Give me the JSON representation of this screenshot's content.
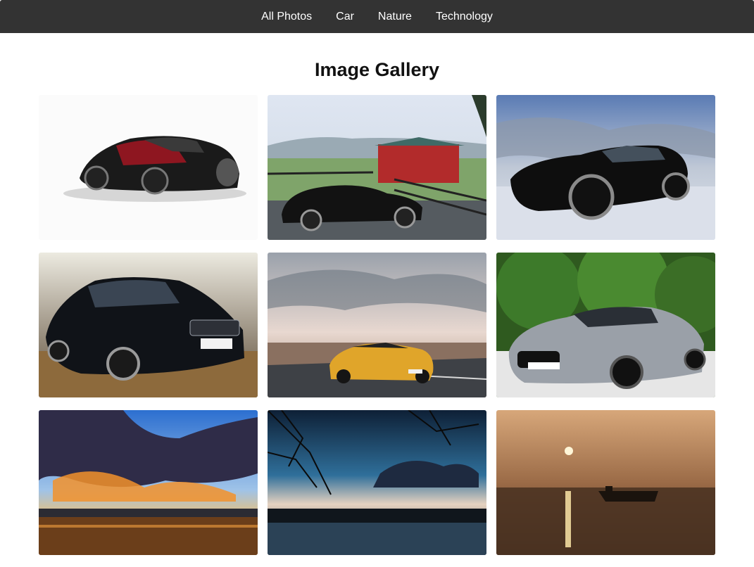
{
  "nav": {
    "items": [
      {
        "label": "All Photos"
      },
      {
        "label": "Car"
      },
      {
        "label": "Nature"
      },
      {
        "label": "Technology"
      }
    ]
  },
  "page": {
    "title": "Image Gallery"
  },
  "gallery": {
    "images": [
      {
        "subject": "red-black-supercar-photo",
        "category": "Car"
      },
      {
        "subject": "black-sedan-farm-photo",
        "category": "Car"
      },
      {
        "subject": "black-mustang-photo",
        "category": "Car"
      },
      {
        "subject": "black-audi-hatchback-photo",
        "category": "Car"
      },
      {
        "subject": "yellow-lamborghini-road-photo",
        "category": "Car"
      },
      {
        "subject": "silver-mercedes-amg-photo",
        "category": "Car"
      },
      {
        "subject": "sunset-clouds-lake-photo",
        "category": "Nature"
      },
      {
        "subject": "dusk-lake-branches-photo",
        "category": "Nature"
      },
      {
        "subject": "sunset-boat-water-photo",
        "category": "Nature"
      }
    ]
  },
  "colors": {
    "navbar_bg": "#333333",
    "nav_text": "#ffffff",
    "title_text": "#111111",
    "page_bg": "#ffffff"
  }
}
